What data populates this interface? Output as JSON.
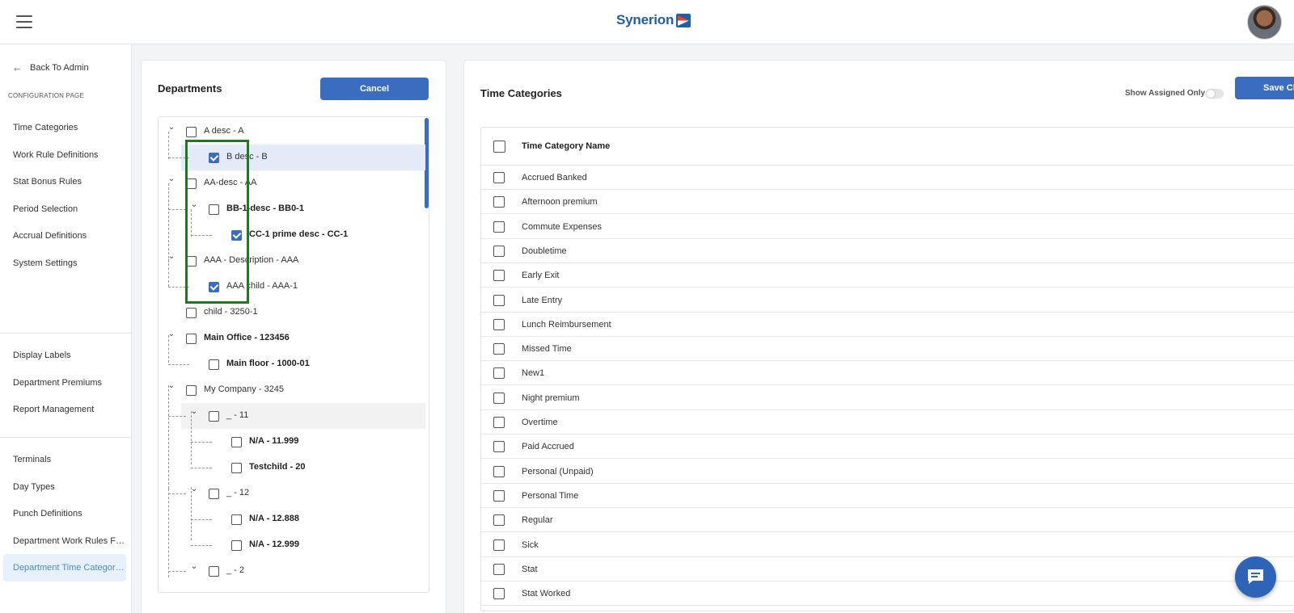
{
  "header": {
    "brand": "Synerion",
    "brand_accent": "#1d5fa8",
    "menu_icon": "hamburger-icon",
    "avatar_icon": "user-avatar"
  },
  "sidebar": {
    "back_label": "Back To Admin",
    "section_label": "CONFIGURATION PAGE",
    "groups": [
      [
        "Time Categories",
        "Work Rule Definitions",
        "Stat Bonus Rules",
        "Period Selection",
        "Accrual Definitions",
        "System Settings"
      ],
      [
        "Display Labels",
        "Department Premiums",
        "Report Management"
      ],
      [
        "Terminals",
        "Day Types",
        "Punch Definitions",
        "Department Work Rules Filt...",
        "Department Time Category ..."
      ]
    ],
    "active_item": "Department Time Category ..."
  },
  "departments": {
    "title": "Departments",
    "cancel_label": "Cancel",
    "nodes": [
      {
        "label": "A desc - A",
        "level": 0,
        "expandable": true,
        "checked": false,
        "bold": false
      },
      {
        "label": "B desc - B",
        "level": 1,
        "expandable": false,
        "checked": true,
        "bold": false,
        "highlight": true
      },
      {
        "label": "AA-desc - AA",
        "level": 0,
        "expandable": true,
        "checked": false,
        "bold": false
      },
      {
        "label": "BB-1-desc - BB0-1",
        "level": 1,
        "expandable": true,
        "checked": false,
        "bold": true
      },
      {
        "label": "CC-1 prime desc - CC-1",
        "level": 2,
        "expandable": false,
        "checked": true,
        "bold": true
      },
      {
        "label": "AAA - Description - AAA",
        "level": 0,
        "expandable": true,
        "checked": false,
        "bold": false
      },
      {
        "label": "AAA child - AAA-1",
        "level": 1,
        "expandable": false,
        "checked": true,
        "bold": false
      },
      {
        "label": "child - 3250-1",
        "level": 0,
        "expandable": false,
        "checked": false,
        "bold": false
      },
      {
        "label": "Main Office - 123456",
        "level": 0,
        "expandable": true,
        "checked": false,
        "bold": true
      },
      {
        "label": "Main floor - 1000-01",
        "level": 1,
        "expandable": false,
        "checked": false,
        "bold": true
      },
      {
        "label": "My Company - 3245",
        "level": 0,
        "expandable": true,
        "checked": false,
        "bold": false
      },
      {
        "label": "_ - 11",
        "level": 1,
        "expandable": true,
        "checked": false,
        "bold": false,
        "hover": true
      },
      {
        "label": "N/A - 11.999",
        "level": 2,
        "expandable": false,
        "checked": false,
        "bold": true
      },
      {
        "label": "Testchild - 20",
        "level": 2,
        "expandable": false,
        "checked": false,
        "bold": true
      },
      {
        "label": "_ - 12",
        "level": 1,
        "expandable": true,
        "checked": false,
        "bold": false
      },
      {
        "label": "N/A - 12.888",
        "level": 2,
        "expandable": false,
        "checked": false,
        "bold": true
      },
      {
        "label": "N/A - 12.999",
        "level": 2,
        "expandable": false,
        "checked": false,
        "bold": true
      },
      {
        "label": "_ - 2",
        "level": 1,
        "expandable": true,
        "checked": false,
        "bold": false
      }
    ]
  },
  "time_categories": {
    "title": "Time Categories",
    "show_assigned_label": "Show Assigned Only",
    "show_assigned_on": false,
    "save_label": "Save Cha",
    "column_header": "Time Category Name",
    "rows": [
      "Accrued Banked",
      "Afternoon premium",
      "Commute Expenses",
      "Doubletime",
      "Early Exit",
      "Late Entry",
      "Lunch Reimbursement",
      "Missed Time",
      "New1",
      "Night premium",
      "Overtime",
      "Paid Accrued",
      "Personal (Unpaid)",
      "Personal Time",
      "Regular",
      "Sick",
      "Stat",
      "Stat Worked"
    ]
  },
  "chat": {
    "icon": "chat-icon"
  },
  "colors": {
    "primary": "#3a6cbf",
    "highlight_box": "#1f7a1f",
    "active_nav_text": "#4a89d3"
  }
}
